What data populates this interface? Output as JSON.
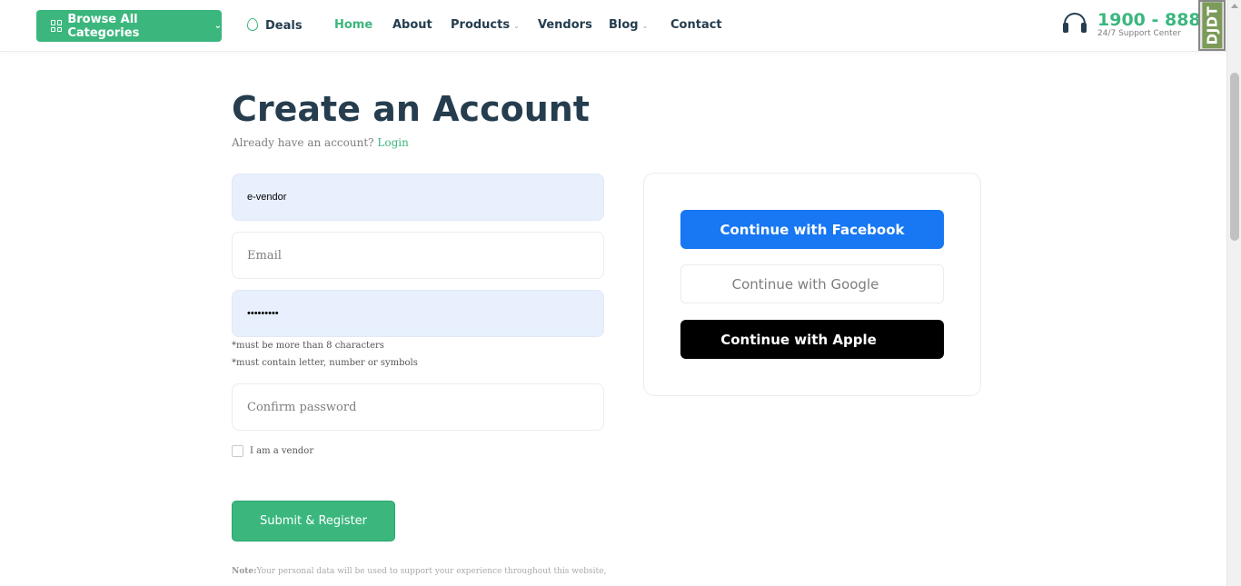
{
  "header": {
    "browse_label": "Browse All Categories",
    "nav": {
      "deals": "Deals",
      "home": "Home",
      "about": "About",
      "products": "Products",
      "vendors": "Vendors",
      "blog": "Blog",
      "contact": "Contact"
    },
    "support_number": "1900 - 888",
    "support_label": "24/7 Support Center",
    "debug_toolbar_label": "DJDT"
  },
  "page": {
    "title": "Create an Account",
    "have_account_text": "Already have an account?",
    "login_link": "Login"
  },
  "form": {
    "username_value": "e-vendor",
    "email_placeholder": "Email",
    "password_value": "•••••••••",
    "hint_length": "*must be more than 8 characters",
    "hint_chars": "*must contain letter, number or symbols",
    "confirm_placeholder": "Confirm password",
    "vendor_label": "I am a vendor",
    "submit_label": "Submit & Register",
    "note_label": "Note:",
    "note_text": "Your personal data will be used to support your experience throughout this website,"
  },
  "social": {
    "facebook": "Continue with Facebook",
    "google": "Continue with Google",
    "apple": "Continue with Apple"
  },
  "colors": {
    "brand_green": "#3bb77e",
    "heading": "#253d4e",
    "facebook_blue": "#1877f2",
    "autofill_bg": "#e8f0fe"
  }
}
